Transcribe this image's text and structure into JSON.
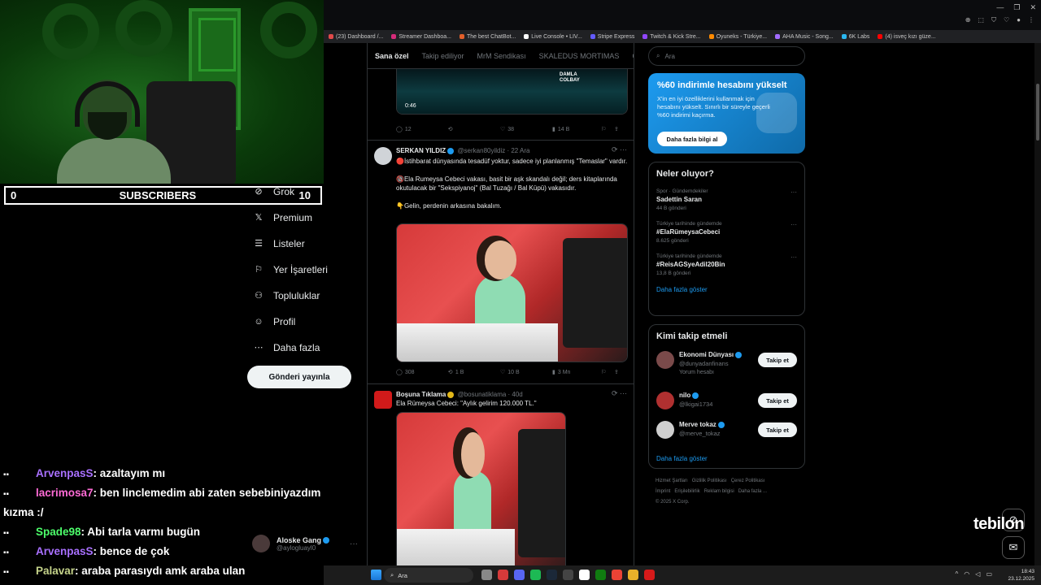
{
  "stream": {
    "subscribers_label": "SUBSCRIBERS",
    "subscribers_left": "0",
    "subscribers_right": "10",
    "watermark": "tebilon"
  },
  "bookmarks": [
    {
      "label": "(23) Dashboard /...",
      "color": "#e04a4a"
    },
    {
      "label": "Streamer Dashboa...",
      "color": "#d62b7a"
    },
    {
      "label": "The best ChatBot...",
      "color": "#e25f2a"
    },
    {
      "label": "Live Console • LIV...",
      "color": "#ffffff"
    },
    {
      "label": "Stripe Express",
      "color": "#635bff"
    },
    {
      "label": "Twitch & Kick Stre...",
      "color": "#9146ff"
    },
    {
      "label": "Oyuneks - Türkiye...",
      "color": "#ff8a00"
    },
    {
      "label": "AHA Music - Song...",
      "color": "#a26bff"
    },
    {
      "label": "6K Labs",
      "color": "#2ab7f0"
    },
    {
      "label": "(4) isveç kızı güze...",
      "color": "#ff0000"
    }
  ],
  "nav": {
    "items": [
      {
        "label": "Grok",
        "icon": "grok-icon",
        "glyph": "⊘"
      },
      {
        "label": "Premium",
        "icon": "x-premium-icon",
        "glyph": "𝕏"
      },
      {
        "label": "Listeler",
        "icon": "list-icon",
        "glyph": "☰"
      },
      {
        "label": "Yer İşaretleri",
        "icon": "bookmark-icon",
        "glyph": "⚐"
      },
      {
        "label": "Topluluklar",
        "icon": "communities-icon",
        "glyph": "⚇"
      },
      {
        "label": "Profil",
        "icon": "profile-icon",
        "glyph": "☺"
      },
      {
        "label": "Daha fazla",
        "icon": "more-icon",
        "glyph": "⋯"
      }
    ],
    "post_button": "Gönderi yayınla",
    "account_name": "Aloske Gang",
    "account_handle": "@aylogluayl0"
  },
  "feed": {
    "tabs": [
      "Sana özel",
      "Takip ediliyor",
      "MrM Sendikası",
      "SKALEDUS MORTIMAS",
      "Oy"
    ],
    "tweet0": {
      "duration": "0:46",
      "brand_line1": "DAMLA",
      "brand_line2": "COLBAY",
      "replies": "12",
      "likes": "38",
      "views": "14 B"
    },
    "tweet1": {
      "name": "SERKAN YILDIZ",
      "handle": "@serkan80yildiz · 22 Ara",
      "p1": "🔴İstihbarat dünyasında tesadüf yoktur, sadece iyi planlanmış \"Temaslar\" vardır.",
      "p2": "🔞Ela Rumeysa Cebeci vakası, basit bir aşk skandalı değil; ders kitaplarında okutulacak bir \"Sekspiyanoj\" (Bal Tuzağı / Bal Küpü) vakasıdır.",
      "p3": "👇Gelin, perdenin arkasına bakalım.",
      "replies": "308",
      "reposts": "1 B",
      "likes": "10 B",
      "views": "3 Mn"
    },
    "tweet2": {
      "name": "Boşuna Tıklama",
      "handle": "@bosunatiklama · 40d",
      "text": "Ela Rümeysa Cebeci: \"Aylık gelirim 120.000 TL.\""
    }
  },
  "sidebar": {
    "search_placeholder": "Ara",
    "promo": {
      "title": "%60 indirimle hesabını yükselt",
      "body": "X'in en iyi özelliklerini kullanmak için hesabını yükselt. Sınırlı bir süreyle geçerli %60 indirimi kaçırma.",
      "button": "Daha fazla bilgi al"
    },
    "trends_title": "Neler oluyor?",
    "trends": [
      {
        "context": "Spor · Gündemdekiler",
        "name": "Sadettin Saran",
        "count": "44 B gönderi"
      },
      {
        "context": "Türkiye tarihinde gündemde",
        "name": "#ElaRümeysaCebeci",
        "count": "8.625 gönderi"
      },
      {
        "context": "Türkiye tarihinde gündemde",
        "name": "#ReisAGSyeAdil20Bin",
        "count": "13,8 B gönderi"
      }
    ],
    "trends_more": "Daha fazla göster",
    "who_title": "Kimi takip etmeli",
    "who": [
      {
        "name": "Ekonomi Dünyası",
        "handle": "@dunyadanfinans",
        "sub": "Yorum hesabı",
        "button": "Takip et",
        "color": "#7a4a4a"
      },
      {
        "name": "nilo",
        "handle": "@lkigai1734",
        "sub": "",
        "button": "Takip et",
        "color": "#b03030"
      },
      {
        "name": "Merve tokaz",
        "handle": "@merve_tokaz",
        "sub": "",
        "button": "Takip et",
        "color": "#cfcfcf"
      }
    ],
    "who_more": "Daha fazla göster",
    "footer": [
      "Hizmet Şartları",
      "Gizlilik Politikası",
      "Çerez Politikası",
      "İmprint",
      "Erişilebilirlik",
      "Reklam bilgisi",
      "Daha fazla ...",
      "© 2025 X Corp."
    ]
  },
  "chat": [
    {
      "user": "ArvenpasS",
      "msg": ": azaltayım mı",
      "color": "#a970ff"
    },
    {
      "user": "lacrimosa7",
      "msg": ": ben linclemedim abi zaten sebebiniyazdım kızma :/",
      "color": "#ff6bd6"
    },
    {
      "user": "Spade98",
      "msg": ": Abi tarla varmı bugün",
      "color": "#4dff6b"
    },
    {
      "user": "ArvenpasS",
      "msg": ": bence de çok",
      "color": "#a970ff"
    },
    {
      "user": "Palavar",
      "msg": ": araba parasıydı amk araba ulan",
      "color": "#c5d38a"
    }
  ],
  "taskbar": {
    "search": "Ara",
    "time": "18:43",
    "date": "23.12.2025"
  }
}
